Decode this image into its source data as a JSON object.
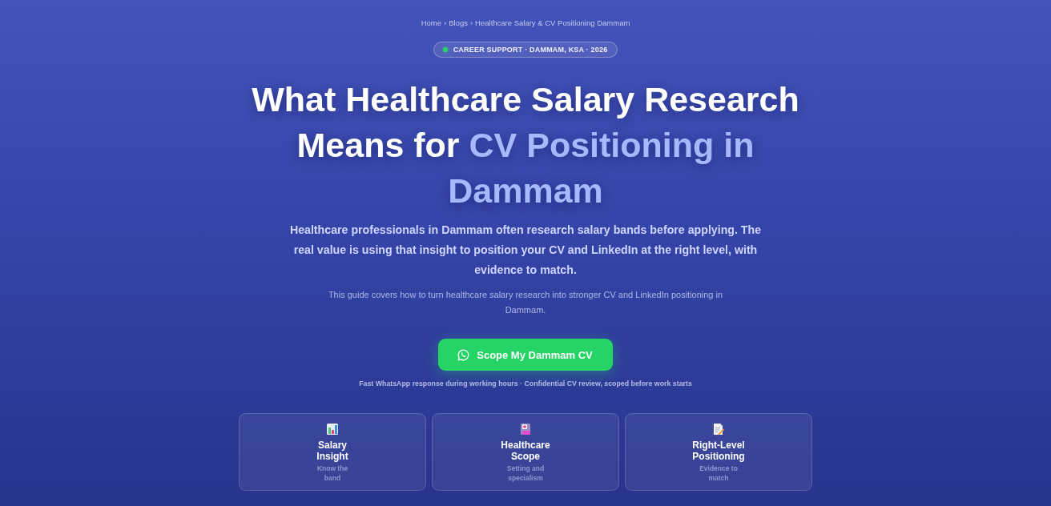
{
  "breadcrumb": {
    "items": [
      {
        "label": "Home"
      },
      {
        "label": "Blogs",
        "separator": "›"
      },
      {
        "label": "Healthcare Salary & CV Positioning Dammam",
        "separator": "›"
      }
    ]
  },
  "badge": {
    "label": "CAREER SUPPORT · DAMMAM, KSA · 2026"
  },
  "title": {
    "text": "What Healthcare Salary Research Means for",
    "highlight": "CV Positioning in Dammam"
  },
  "lead": "Healthcare professionals in Dammam often research salary bands before applying. The real value is using that insight to position your CV and LinkedIn at the right level, with evidence to match.",
  "summary": "This guide covers how to turn healthcare salary research into stronger CV and LinkedIn positioning in Dammam.",
  "cta": {
    "label": "Scope My Dammam CV"
  },
  "note": "Fast WhatsApp response during working hours · Confidential CV review, scoped before work starts",
  "features": [
    {
      "title": "Salary Insight",
      "subtitle": "Know the band"
    },
    {
      "title": "Healthcare Scope",
      "subtitle": "Setting and specialism"
    },
    {
      "title": "Right-Level Positioning",
      "subtitle": "Evidence to match"
    }
  ]
}
